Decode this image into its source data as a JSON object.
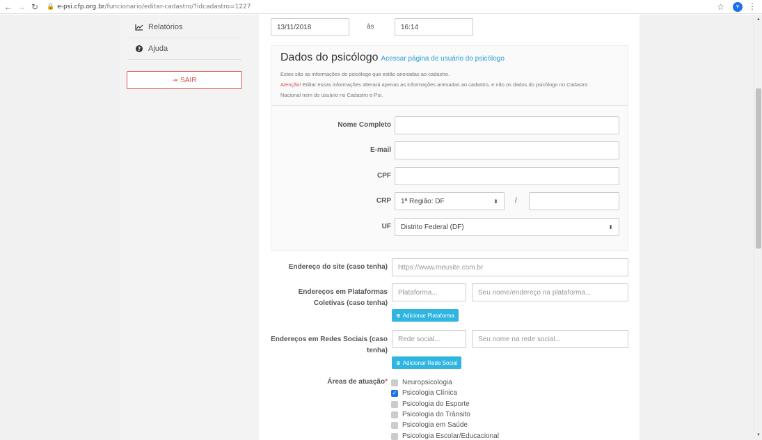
{
  "browser": {
    "url_host": "e-psi.cfp.org.br",
    "url_path": "/funcionario/editar-cadastro/?idcadastro=1227",
    "profile_initial": "Y"
  },
  "sidebar": {
    "items": [
      {
        "label": "Relatórios",
        "icon": "chart-line-icon"
      },
      {
        "label": "Ajuda",
        "icon": "question-circle-icon"
      }
    ],
    "logout_label": "SAIR"
  },
  "datetime": {
    "date": "13/11/2018",
    "separator": "às",
    "time": "16:14"
  },
  "panel": {
    "title": "Dados do psicólogo",
    "link": "Acessar página de usuário do psicólogo",
    "info1": "Estes são as informações do psicólogo que estão anexadas ao cadastro.",
    "warn_prefix": "Atenção!",
    "info2": " Editar essas informações alterará apenas as informações anexadas ao cadastro, e não os dados do psicólogo no Cadastro",
    "info3": "Nacional nem do usuário no Cadastro e-Psi.",
    "fields": {
      "nome_label": "Nome Completo",
      "nome_value": "",
      "email_label": "E-mail",
      "email_value": "",
      "cpf_label": "CPF",
      "cpf_value": "",
      "crp_label": "CRP",
      "crp_region": "1ª Região: DF",
      "crp_slash": "/",
      "crp_number": "",
      "uf_label": "UF",
      "uf_value": "Distrito Federal (DF)"
    }
  },
  "extra": {
    "site_label": "Endereço do site (caso tenha)",
    "site_placeholder": "https://www.meusite.com.br",
    "plataformas_label_1": "Endereços em Plataformas",
    "plataformas_label_2": "Coletivas (caso tenha)",
    "plataforma_placeholder": "Plataforma...",
    "plataforma_nome_placeholder": "Seu nome/endereço na plataforma...",
    "add_plataforma": "Adicionar Plataforma",
    "redes_label_1": "Endereços em Redes Sociais (caso",
    "redes_label_2": "tenha)",
    "rede_placeholder": "Rede social...",
    "rede_nome_placeholder": "Seu nome na rede social...",
    "add_rede": "Adicionar Rede Social",
    "areas_label": "Áreas de atuação",
    "required_mark": "*",
    "areas": [
      {
        "label": "Neuropsicologia",
        "checked": false
      },
      {
        "label": "Psicologia Clínica",
        "checked": true
      },
      {
        "label": "Psicologia do Esporte",
        "checked": false
      },
      {
        "label": "Psicologia do Trânsito",
        "checked": false
      },
      {
        "label": "Psicologia em Saúde",
        "checked": false
      },
      {
        "label": "Psicologia Escolar/Educacional",
        "checked": false
      }
    ]
  }
}
